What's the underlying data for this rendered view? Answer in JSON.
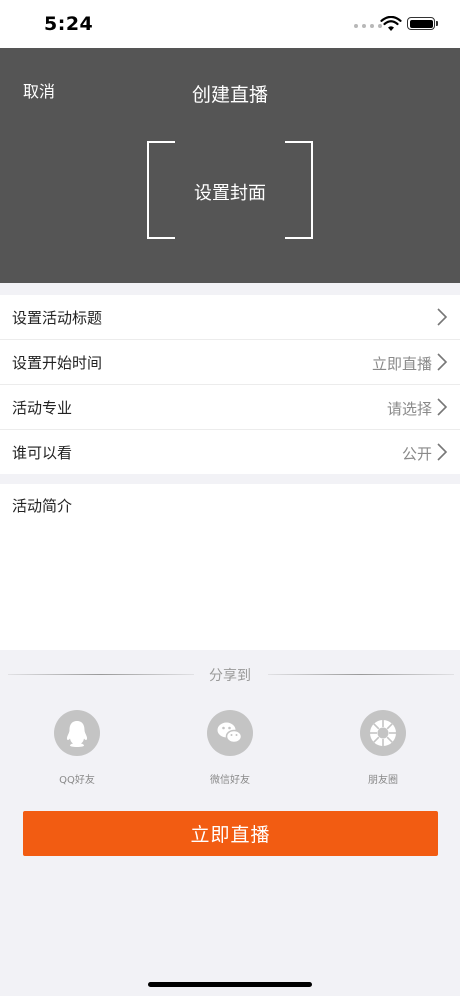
{
  "status_bar": {
    "time": "5:24"
  },
  "header": {
    "cancel_label": "取消",
    "title": "创建直播",
    "cover_label": "设置封面"
  },
  "settings": [
    {
      "label": "设置活动标题",
      "value": ""
    },
    {
      "label": "设置开始时间",
      "value": "立即直播"
    },
    {
      "label": "活动专业",
      "value": "请选择"
    },
    {
      "label": "谁可以看",
      "value": "公开"
    }
  ],
  "intro": {
    "label": "活动简介"
  },
  "share": {
    "title": "分享到",
    "items": [
      {
        "label": "QQ好友",
        "icon": "qq-icon"
      },
      {
        "label": "微信好友",
        "icon": "wechat-icon"
      },
      {
        "label": "朋友圈",
        "icon": "moments-icon"
      }
    ]
  },
  "primary_button": {
    "label": "立即直播"
  },
  "colors": {
    "header_bg": "#555555",
    "accent": "#f25c12",
    "icon_gray": "#c4c4c4"
  }
}
